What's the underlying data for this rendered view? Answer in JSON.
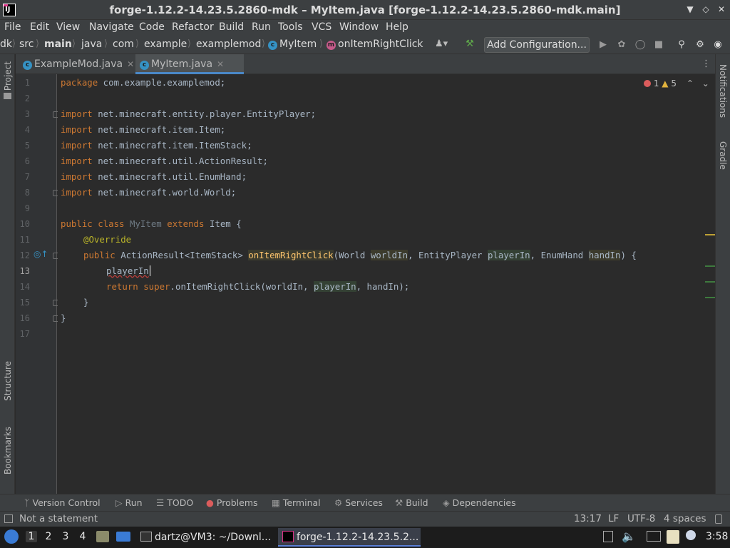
{
  "window": {
    "title": "forge-1.12.2-14.23.5.2860-mdk – MyItem.java [forge-1.12.2-14.23.5.2860-mdk.main]",
    "app_icon_text": "IJ"
  },
  "menu": [
    "File",
    "Edit",
    "View",
    "Navigate",
    "Code",
    "Refactor",
    "Build",
    "Run",
    "Tools",
    "VCS",
    "Window",
    "Help"
  ],
  "breadcrumb": {
    "items": [
      "dk",
      "src",
      "main",
      "java",
      "com",
      "example",
      "examplemod",
      "MyItem",
      "onItemRightClick"
    ]
  },
  "toolbar": {
    "add_configuration": "Add Configuration..."
  },
  "left_stripe": {
    "project": "Project",
    "structure": "Structure",
    "bookmarks": "Bookmarks"
  },
  "right_stripe": {
    "notifications": "Notifications",
    "gradle": "Gradle"
  },
  "tabs": [
    {
      "label": "ExampleMod.java",
      "active": false
    },
    {
      "label": "MyItem.java",
      "active": true
    }
  ],
  "inspections": {
    "errors": "1",
    "warnings": "5"
  },
  "editor": {
    "line_numbers": [
      "1",
      "2",
      "3",
      "4",
      "5",
      "6",
      "7",
      "8",
      "9",
      "10",
      "11",
      "12",
      "13",
      "14",
      "15",
      "16",
      "17"
    ],
    "current_line": "13",
    "lines": {
      "l1_kw": "package",
      "l1_rest": " com.example.examplemod;",
      "import_kw": "import",
      "l3": " net.minecraft.entity.player.EntityPlayer;",
      "l4": " net.minecraft.item.Item;",
      "l5": " net.minecraft.item.ItemStack;",
      "l6": " net.minecraft.util.ActionResult;",
      "l7": " net.minecraft.util.EnumHand;",
      "l8": " net.minecraft.world.World;",
      "l10_kw": "public class",
      "l10_cls": "MyItem",
      "l10_ext": "extends",
      "l10_rest": " Item {",
      "l11": "@Override",
      "l12_kw": "public",
      "l12_type": " ActionResult<ItemStack> ",
      "l12_method": "onItemRightClick",
      "l12_p1": "(World ",
      "l12_world": "worldIn",
      "l12_p2": ", EntityPlayer ",
      "l12_player": "playerIn",
      "l12_p3": ", EnumHand ",
      "l12_hand": "handIn",
      "l12_end": ") {",
      "l13": "playerIn",
      "l14_kw": "return super",
      "l14_a": ".onItemRightClick(worldIn, ",
      "l14_player": "playerIn",
      "l14_b": ", handIn);",
      "l15": "}",
      "l16": "}"
    }
  },
  "bottom_tools": [
    "Version Control",
    "Run",
    "TODO",
    "Problems",
    "Terminal",
    "Services",
    "Build",
    "Dependencies"
  ],
  "status": {
    "message": "Not a statement",
    "position": "13:17",
    "line_sep": "LF",
    "encoding": "UTF-8",
    "indent": "4 spaces"
  },
  "taskbar": {
    "workspaces": [
      "1",
      "2",
      "3",
      "4"
    ],
    "terminal_task": "dartz@VM3: ~/Downl...",
    "ide_task": "forge-1.12.2-14.23.5.2...",
    "clock": "3:58"
  },
  "colors": {
    "keyword": "#cc7832",
    "annotation": "#bbb529",
    "method": "#ffc66d",
    "error": "#bc3f3c",
    "accent": "#4a88c7"
  }
}
